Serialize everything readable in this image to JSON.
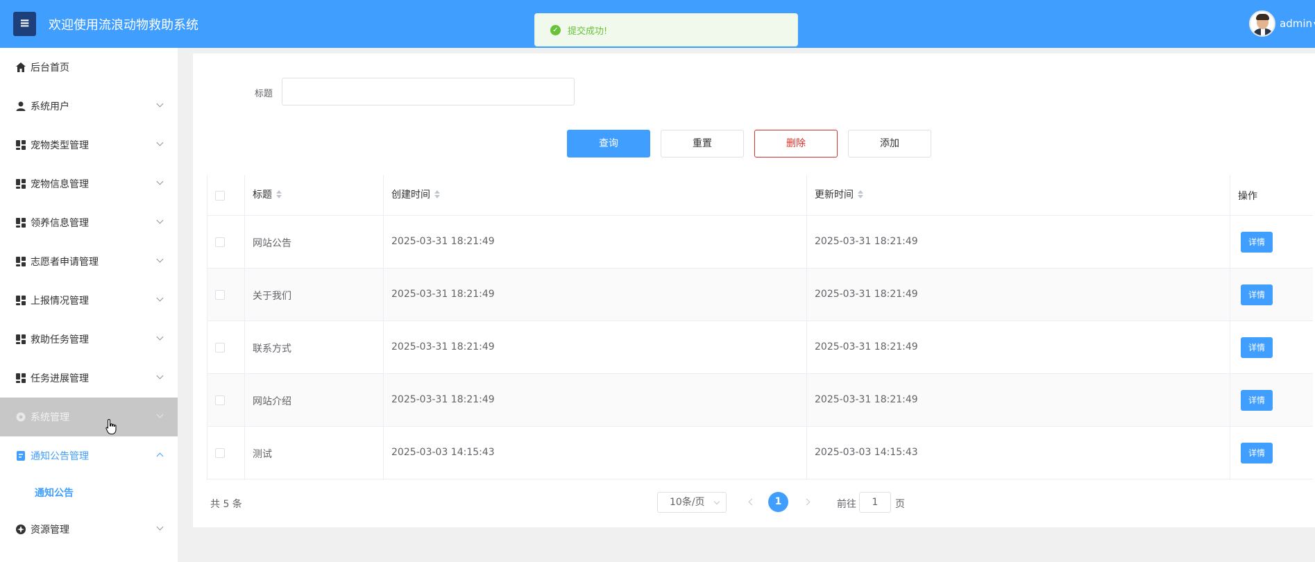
{
  "header": {
    "menu_icon": "hamburger-icon",
    "title": "欢迎使用流浪动物救助系统",
    "username": "admin",
    "username_caret": "▾"
  },
  "toast": {
    "text": "提交成功!",
    "icon": "check-circle-icon",
    "icon_glyph": "✓",
    "color": "#67c23a"
  },
  "sidebar": {
    "items": [
      {
        "label": "后台首页",
        "icon": "home-icon"
      },
      {
        "label": "系统用户",
        "icon": "user-icon"
      },
      {
        "label": "宠物类型管理",
        "icon": "grid-icon"
      },
      {
        "label": "宠物信息管理",
        "icon": "grid-icon"
      },
      {
        "label": "领养信息管理",
        "icon": "grid-icon"
      },
      {
        "label": "志愿者申请管理",
        "icon": "grid-icon"
      },
      {
        "label": "上报情况管理",
        "icon": "grid-icon"
      },
      {
        "label": "救助任务管理",
        "icon": "grid-icon"
      },
      {
        "label": "任务进展管理",
        "icon": "grid-icon"
      },
      {
        "label": "系统管理",
        "icon": "gear-icon"
      },
      {
        "label": "通知公告管理",
        "icon": "document-icon"
      },
      {
        "label": "资源管理",
        "icon": "resource-icon"
      }
    ],
    "subitem": {
      "label": "通知公告"
    }
  },
  "search": {
    "label": "标题",
    "value": "",
    "placeholder": ""
  },
  "actions": {
    "query": "查询",
    "reset": "重置",
    "delete": "删除",
    "add": "添加"
  },
  "table": {
    "columns": [
      "标题",
      "创建时间",
      "更新时间",
      "操作"
    ],
    "rows": [
      {
        "title": "网站公告",
        "created": "2025-03-31 18:21:49",
        "updated": "2025-03-31 18:21:49",
        "action": "详情"
      },
      {
        "title": "关于我们",
        "created": "2025-03-31 18:21:49",
        "updated": "2025-03-31 18:21:49",
        "action": "详情"
      },
      {
        "title": "联系方式",
        "created": "2025-03-31 18:21:49",
        "updated": "2025-03-31 18:21:49",
        "action": "详情"
      },
      {
        "title": "网站介绍",
        "created": "2025-03-31 18:21:49",
        "updated": "2025-03-31 18:21:49",
        "action": "详情"
      },
      {
        "title": "测试",
        "created": "2025-03-03 14:15:43",
        "updated": "2025-03-03 14:15:43",
        "action": "详情"
      }
    ]
  },
  "pagination": {
    "total": "共 5 条",
    "page_size": "10条/页",
    "current_page": "1",
    "goto_label": "前往",
    "goto_value": "1",
    "goto_suffix": "页"
  },
  "colors": {
    "primary": "#409eff",
    "danger": "#d9312a",
    "menu_button": "#1d3f7a"
  }
}
